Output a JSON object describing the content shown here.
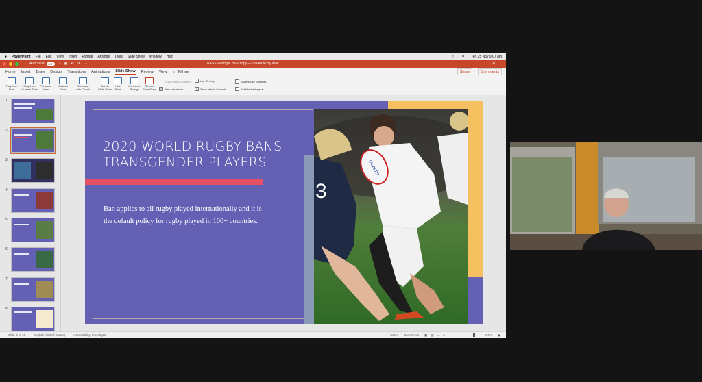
{
  "menubar": {
    "app": "PowerPoint",
    "items": [
      "File",
      "Edit",
      "View",
      "Insert",
      "Format",
      "Arrange",
      "Tools",
      "Slide Show",
      "Window",
      "Help"
    ],
    "clock": "Fri 25 Nov  9:07 am"
  },
  "titlebar": {
    "autosave": "AutoSave",
    "autosave_state": "OFF",
    "doc_title": "NASSS Pringle 2022 copy — Saved to my Mac"
  },
  "tabs": [
    "Home",
    "Insert",
    "Draw",
    "Design",
    "Transitions",
    "Animations",
    "Slide Show",
    "Review",
    "View",
    "Tell me"
  ],
  "share_label": "Share",
  "comments_label": "Comments",
  "ribbon": {
    "play_start": [
      "Play from",
      "Start"
    ],
    "play_current": [
      "Play from",
      "Current Slide"
    ],
    "presenter": [
      "Presenter",
      "View"
    ],
    "custom": [
      "Custom",
      "Show"
    ],
    "rehearse_coach": [
      "Rehearse",
      "with Coach"
    ],
    "setup": [
      "Set Up",
      "Slide Show"
    ],
    "hide": [
      "Hide",
      "Slide"
    ],
    "rehearse_timings": [
      "Rehearse",
      "Timings"
    ],
    "record": [
      "Record",
      "Slide Show"
    ],
    "keep_updated": "Keep Slides Updated",
    "use_timings": "Use Timings",
    "play_narrations": "Play Narrations",
    "show_media": "Show Media Controls",
    "always_subtitles": "Always Use Subtitles",
    "subtitle_settings": "Subtitle Settings"
  },
  "thumbnails": [
    1,
    2,
    3,
    4,
    5,
    6,
    7,
    8
  ],
  "slide": {
    "title": "2020 WORLD RUGBY BANS TRANSGENDER PLAYERS",
    "body": "Ban applies to all rugby played internationally and it is the default policy for rugby played in 100+ countries.",
    "jersey_number": "3",
    "ball_text": "GILBERT"
  },
  "status": {
    "slide": "Slide 2 of 16",
    "language": "English (United States)",
    "accessibility": "Accessibility: Investigate",
    "notes": "Notes",
    "comments": "Comments",
    "zoom": "157%"
  }
}
